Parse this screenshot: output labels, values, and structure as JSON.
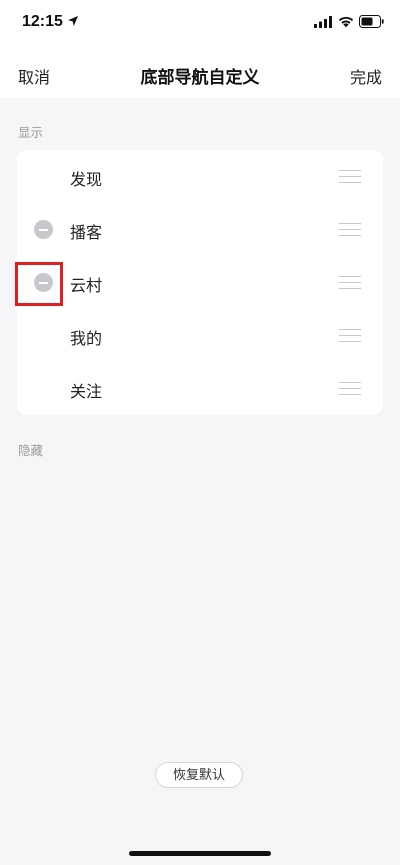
{
  "status_bar": {
    "time": "12:15",
    "icons": [
      "location-arrow-icon",
      "cellular-signal-icon",
      "wifi-icon",
      "battery-icon"
    ]
  },
  "nav": {
    "cancel_label": "取消",
    "title": "底部导航自定义",
    "done_label": "完成"
  },
  "sections": {
    "shown_label": "显示",
    "hidden_label": "隐藏"
  },
  "shown_items": [
    {
      "label": "发现",
      "removable": false
    },
    {
      "label": "播客",
      "removable": true
    },
    {
      "label": "云村",
      "removable": true
    },
    {
      "label": "我的",
      "removable": false
    },
    {
      "label": "关注",
      "removable": false
    }
  ],
  "reset_label": "恢复默认",
  "colors": {
    "background": "#f6f6f8",
    "card": "#ffffff",
    "minus_button": "#c7c7cc",
    "highlight": "#e02020"
  }
}
